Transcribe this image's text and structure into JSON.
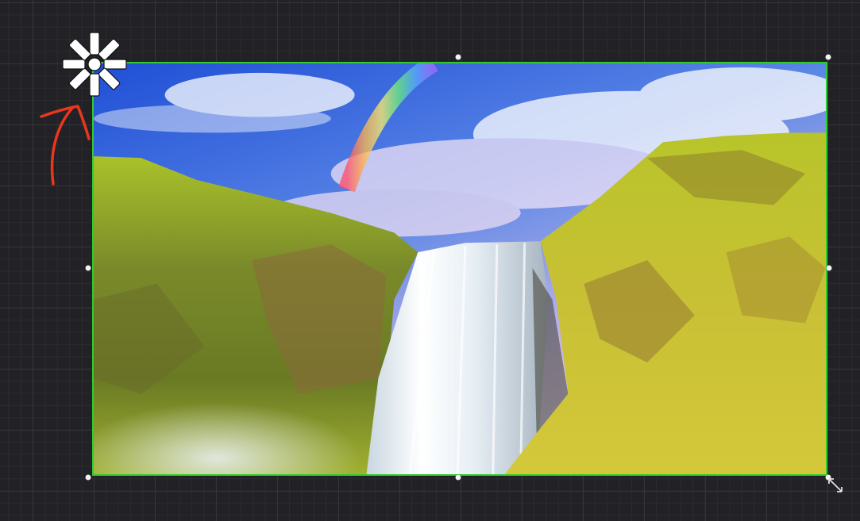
{
  "canvas": {
    "background": "#222226",
    "grid_color": "#34343a"
  },
  "image": {
    "subject": "waterfall-landscape",
    "selection_color": "#2ecc2e"
  },
  "icons": {
    "rotate": "asterisk-rotate-icon",
    "resize": "diagonal-resize-icon",
    "annotation": "red-arrow-annotation"
  }
}
